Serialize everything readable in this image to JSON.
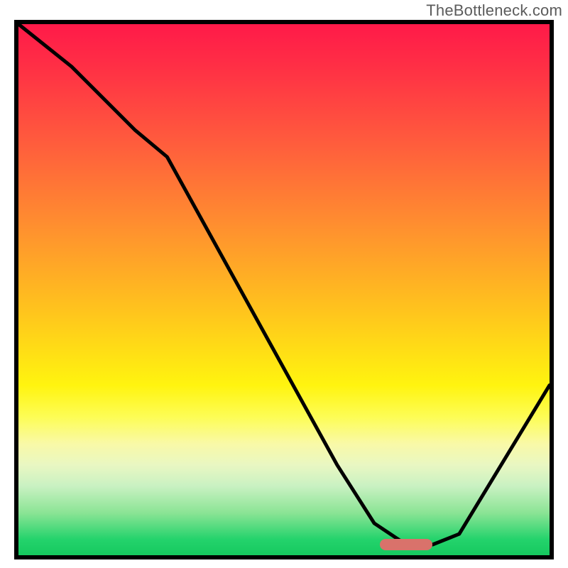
{
  "watermark": "TheBottleneck.com",
  "colors": {
    "frame": "#000000",
    "curve": "#000000",
    "marker": "#d9726b",
    "gradient_top": "#ff1a49",
    "gradient_bottom": "#16c95f"
  },
  "chart_data": {
    "type": "line",
    "title": "",
    "xlabel": "",
    "ylabel": "",
    "xlim": [
      0,
      100
    ],
    "ylim": [
      0,
      100
    ],
    "x": [
      0,
      10,
      22,
      28,
      60,
      67,
      73,
      78,
      83,
      100
    ],
    "values": [
      100,
      92,
      80,
      75,
      17,
      6,
      2,
      2,
      4,
      32
    ],
    "minimum_region": {
      "x_start": 68,
      "x_end": 78,
      "y": 2
    },
    "annotations": []
  }
}
